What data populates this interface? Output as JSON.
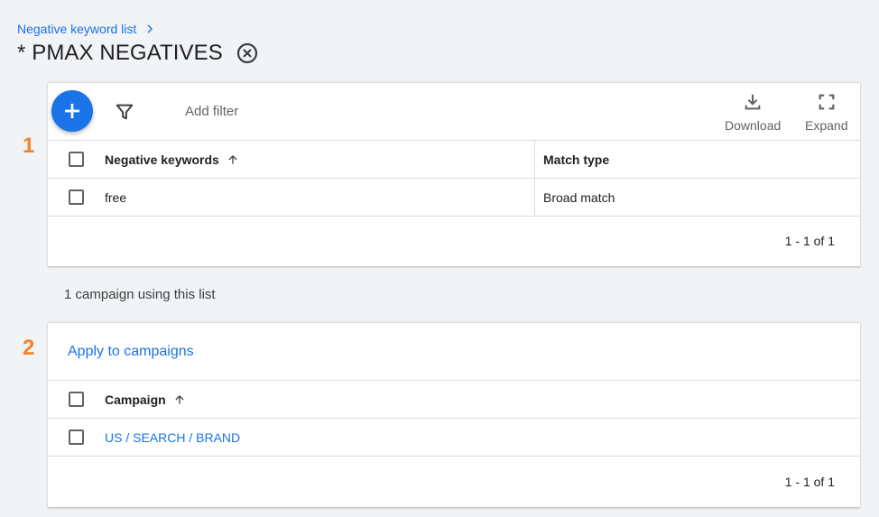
{
  "breadcrumb": {
    "label": "Negative keyword list"
  },
  "page": {
    "title": "* PMAX NEGATIVES"
  },
  "steps": {
    "one": "1",
    "two": "2"
  },
  "keywords_table": {
    "add_filter": "Add filter",
    "download_label": "Download",
    "expand_label": "Expand",
    "columns": [
      "Negative keywords",
      "Match type"
    ],
    "rows": [
      {
        "keyword": "free",
        "match_type": "Broad match"
      }
    ],
    "pagination": "1 - 1 of 1"
  },
  "campaigns_section": {
    "summary": "1 campaign using this list",
    "apply_label": "Apply to campaigns",
    "column": "Campaign",
    "rows": [
      {
        "campaign": "US / SEARCH / BRAND"
      }
    ],
    "pagination": "1 - 1 of 1"
  },
  "colors": {
    "accent": "#1a73e8",
    "step": "#f5822a",
    "background": "#f1f3f4"
  },
  "icons": [
    "chevron-right-icon",
    "close-circle-icon",
    "plus-icon",
    "filter-icon",
    "download-icon",
    "expand-icon",
    "arrow-up-icon"
  ]
}
